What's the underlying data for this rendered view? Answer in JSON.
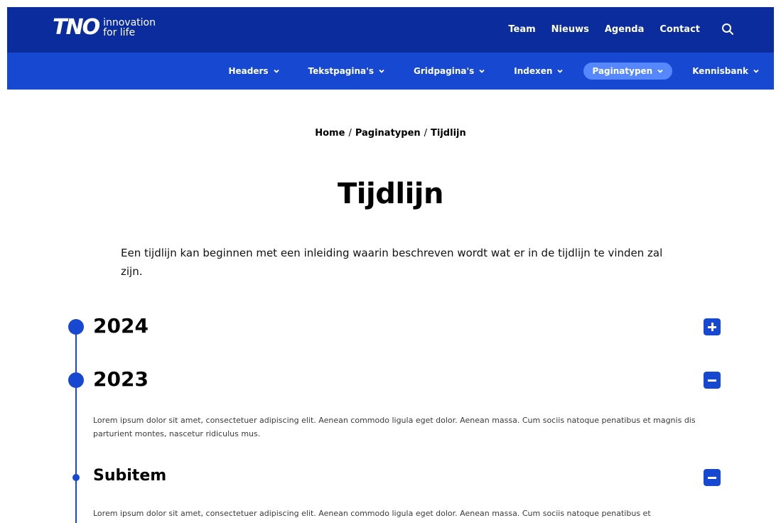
{
  "header": {
    "logo_text": "TNO",
    "tagline_line1": "innovation",
    "tagline_line2": "for life",
    "util_links": [
      "Team",
      "Nieuws",
      "Agenda",
      "Contact"
    ],
    "search_icon": "search-icon"
  },
  "main_nav": [
    {
      "label": "Headers",
      "active": false
    },
    {
      "label": "Tekstpagina's",
      "active": false
    },
    {
      "label": "Gridpagina's",
      "active": false
    },
    {
      "label": "Indexen",
      "active": false
    },
    {
      "label": "Paginatypen",
      "active": true
    },
    {
      "label": "Kennisbank",
      "active": false
    }
  ],
  "breadcrumb": {
    "home": "Home",
    "parent": "Paginatypen",
    "current": "Tijdlijn",
    "separator": "/"
  },
  "page": {
    "title": "Tijdlijn",
    "intro": "Een tijdlijn kan beginnen met een inleiding waarin beschreven wordt wat er in de tijdlijn te vinden zal zijn."
  },
  "timeline": {
    "items": [
      {
        "label": "2024",
        "expanded": false,
        "body": ""
      },
      {
        "label": "2023",
        "expanded": true,
        "body": "Lorem ipsum dolor sit amet, consectetuer adipiscing elit. Aenean commodo ligula eget dolor. Aenean massa. Cum sociis natoque penatibus et magnis dis parturient montes, nascetur ridiculus mus."
      },
      {
        "label": "Subitem",
        "expanded": true,
        "body": "Lorem ipsum dolor sit amet, consectetuer adipiscing elit. Aenean commodo ligula eget dolor. Aenean massa. Cum sociis natoque penatibus et"
      }
    ]
  },
  "colors": {
    "topbar": "#0b2c9c",
    "mainbar": "#1748d1",
    "active_pill": "#5687ff",
    "accent": "#1748d1"
  }
}
